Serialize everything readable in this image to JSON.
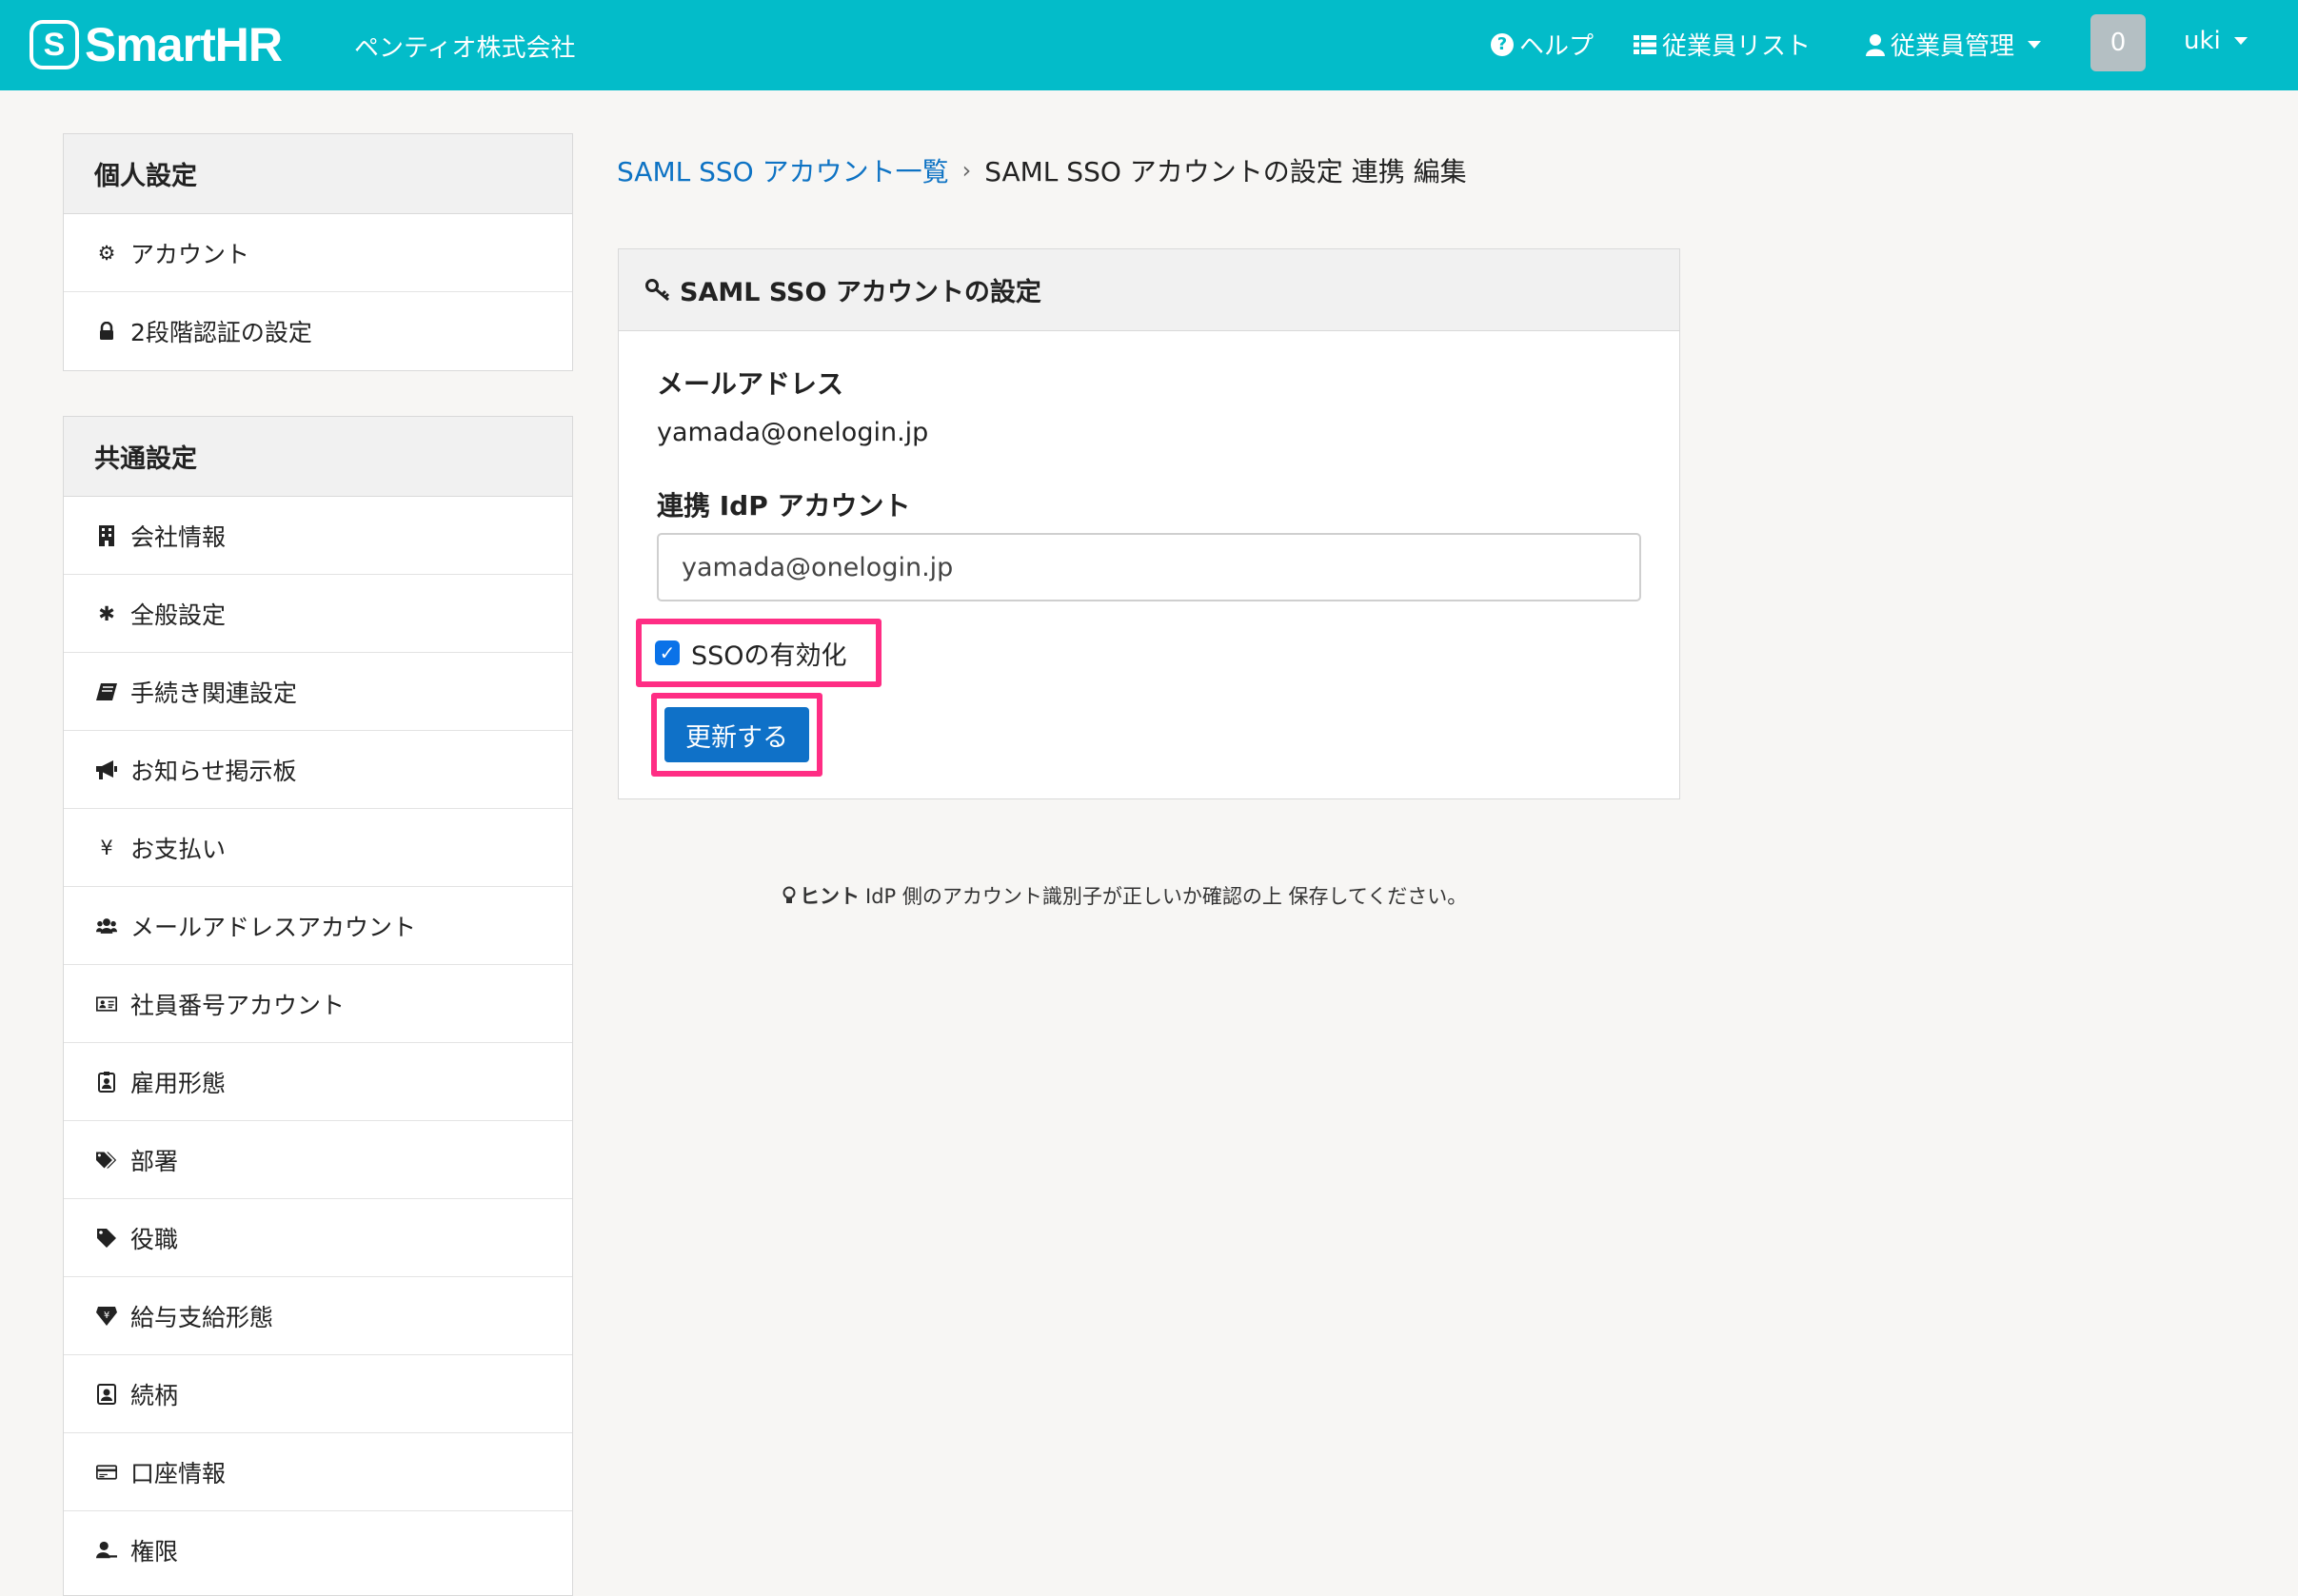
{
  "header": {
    "logo_mark": "S",
    "logo_text": "SmartHR",
    "company": "ペンティオ株式会社",
    "help_label": "ヘルプ",
    "employee_list_label": "従業員リスト",
    "employee_mgmt_label": "従業員管理",
    "notification_count": "0",
    "user_name": "uki",
    "background_color": "#03bcc9"
  },
  "sidebar": {
    "personal": {
      "title": "個人設定",
      "items": [
        {
          "label": "アカウント",
          "icon": "gear-icon"
        },
        {
          "label": "2段階認証の設定",
          "icon": "lock-icon"
        }
      ]
    },
    "common": {
      "title": "共通設定",
      "items": [
        {
          "label": "会社情報",
          "icon": "building-icon"
        },
        {
          "label": "全般設定",
          "icon": "asterisk-icon"
        },
        {
          "label": "手続き関連設定",
          "icon": "book-icon"
        },
        {
          "label": "お知らせ掲示板",
          "icon": "megaphone-icon"
        },
        {
          "label": "お支払い",
          "icon": "yen-icon"
        },
        {
          "label": "メールアドレスアカウント",
          "icon": "users-icon"
        },
        {
          "label": "社員番号アカウント",
          "icon": "id-card-icon"
        },
        {
          "label": "雇用形態",
          "icon": "badge-icon"
        },
        {
          "label": "部署",
          "icon": "tags-icon"
        },
        {
          "label": "役職",
          "icon": "tag-icon"
        },
        {
          "label": "給与支給形態",
          "icon": "money-icon"
        },
        {
          "label": "続柄",
          "icon": "contact-icon"
        },
        {
          "label": "口座情報",
          "icon": "bank-card-icon"
        },
        {
          "label": "権限",
          "icon": "user-key-icon"
        }
      ]
    }
  },
  "breadcrumb": {
    "link": "SAML SSO アカウント一覧",
    "separator": "›",
    "current": "SAML SSO アカウントの設定 連携 編集"
  },
  "card": {
    "title": "SAML SSO アカウントの設定",
    "email_label": "メールアドレス",
    "email_value": "yamada@onelogin.jp",
    "idp_label": "連携 IdP アカウント",
    "idp_value": "yamada@onelogin.jp",
    "sso_checkbox_label": "SSOの有効化",
    "sso_checked": true,
    "submit_label": "更新する",
    "highlight_color": "#ff2d84"
  },
  "hint": {
    "title": "ヒント",
    "text": "IdP 側のアカウント識別子が正しいか確認の上 保存してください。"
  }
}
